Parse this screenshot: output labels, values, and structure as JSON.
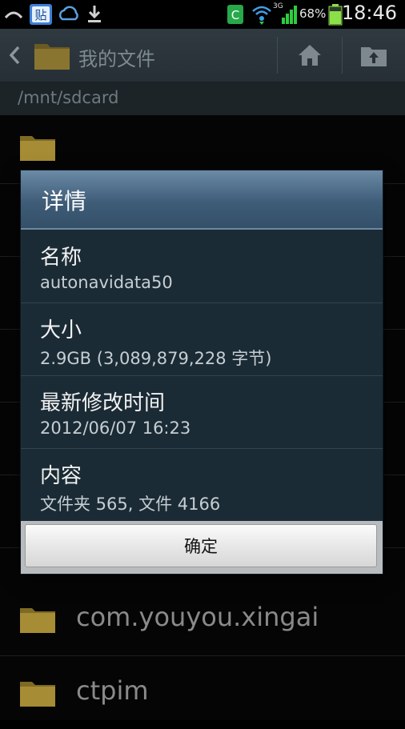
{
  "status_bar": {
    "time": "18:46",
    "battery_percent": "68%",
    "network_label": "3G",
    "icons": [
      "phone-missed-icon",
      "notes-app-icon",
      "sync-cloud-icon",
      "download-icon",
      "c-app-icon",
      "wifi-icon",
      "signal-icon",
      "battery-icon"
    ]
  },
  "action_bar": {
    "title": "我的文件",
    "back_icon": "chevron-left-icon",
    "folder_icon": "folder-icon",
    "home_icon": "home-icon",
    "up_icon": "folder-up-icon"
  },
  "path": "/mnt/sdcard",
  "list": {
    "items": [
      {
        "name": "",
        "icon": "folder-icon"
      },
      {
        "name": "",
        "icon": "folder-icon"
      },
      {
        "name": "",
        "icon": "folder-icon"
      },
      {
        "name": "",
        "icon": "folder-icon"
      },
      {
        "name": "",
        "icon": "folder-icon"
      },
      {
        "name": "",
        "icon": "folder-icon"
      },
      {
        "name": "com.youyou.xingai",
        "icon": "folder-icon"
      },
      {
        "name": "ctpim",
        "icon": "folder-icon"
      }
    ]
  },
  "dialog": {
    "title": "详情",
    "fields": [
      {
        "label": "名称",
        "value": "autonavidata50"
      },
      {
        "label": "大小",
        "value": "2.9GB (3,089,879,228 字节)"
      },
      {
        "label": "最新修改时间",
        "value": "2012/06/07 16:23"
      },
      {
        "label": "内容",
        "value": "文件夹 565, 文件 4166"
      }
    ],
    "ok_label": "确定"
  },
  "colors": {
    "dialog_header": "#4a6a86",
    "dialog_body": "#1b2b35",
    "folder": "#b89a3a",
    "action_bar": "#2b353b"
  }
}
